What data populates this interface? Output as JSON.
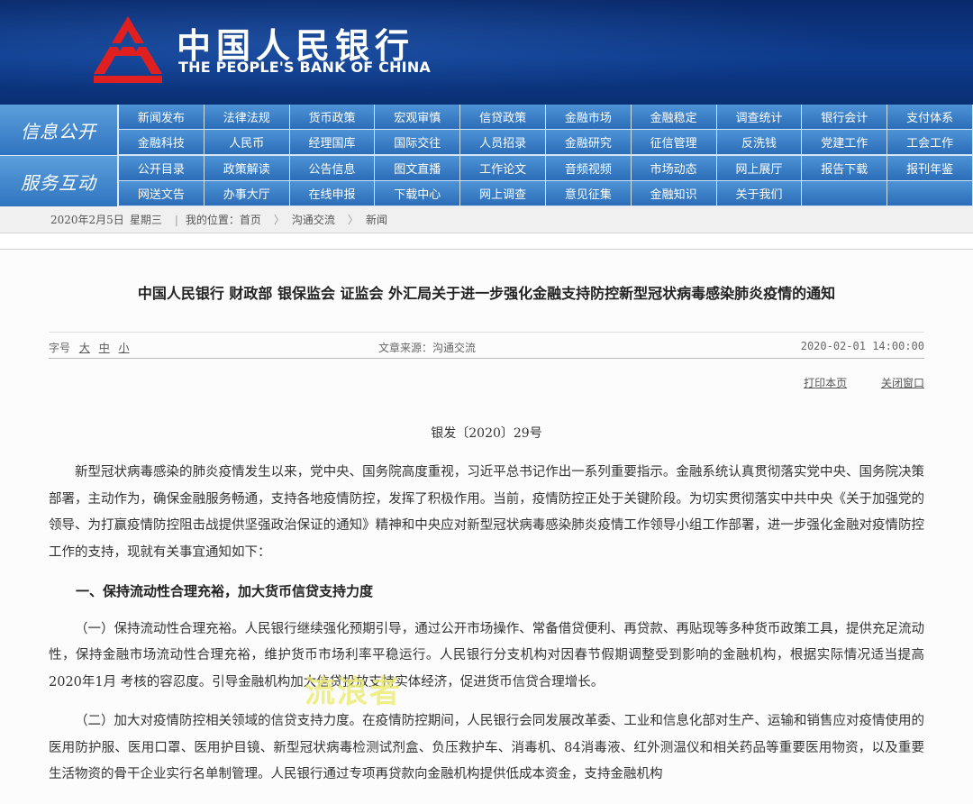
{
  "header": {
    "bank_name_cn": "中国人民银行",
    "bank_name_en": "THE PEOPLE'S BANK OF CHINA",
    "logo_icon": "pboc-logo-icon",
    "logo_color": "#e02020"
  },
  "nav": {
    "section1_label": "信息公开",
    "section1_items": [
      "新闻发布",
      "法律法规",
      "货币政策",
      "宏观审慎",
      "信贷政策",
      "金融市场",
      "金融稳定",
      "调查统计",
      "银行会计",
      "支付体系",
      "金融科技",
      "人民币",
      "经理国库",
      "国际交往",
      "人员招录",
      "金融研究",
      "征信管理",
      "反洗钱",
      "党建工作",
      "工会工作"
    ],
    "section2_label": "服务互动",
    "section2_items": [
      "公开目录",
      "政策解读",
      "公告信息",
      "图文直播",
      "工作论文",
      "音频视频",
      "市场动态",
      "网上展厅",
      "报告下载",
      "报刊年鉴",
      "网送文告",
      "办事大厅",
      "在线申报",
      "下载中心",
      "网上调查",
      "意见征集",
      "金融知识",
      "关于我们",
      "",
      ""
    ]
  },
  "breadcrumb": {
    "date": "2020年2月5日",
    "weekday": "星期三",
    "prefix": "我的位置：首页",
    "level1": "沟通交流",
    "level2": "新闻",
    "separator": "〉"
  },
  "article": {
    "title": "中国人民银行 财政部 银保监会 证监会 外汇局关于进一步强化金融支持防控新型冠状病毒感染肺炎疫情的通知",
    "font_size_label": "字号",
    "font_sizes": [
      "大",
      "中",
      "小"
    ],
    "source": "文章来源：沟通交流",
    "date": "2020-02-01 14:00:00",
    "print_label": "打印本页",
    "close_label": "关闭窗口",
    "doc_number": "银发〔2020〕29号",
    "para1": "新型冠状病毒感染的肺炎疫情发生以来，党中央、国务院高度重视，习近平总书记作出一系列重要指示。金融系统认真贯彻落实党中央、国务院决策部署，主动作为，确保金融服务畅通，支持各地疫情防控，发挥了积极作用。当前，疫情防控正处于关键阶段。为切实贯彻落实中共中央《关于加强党的领导、为打赢疫情防控阻击战提供坚强政治保证的通知》精神和中央应对新型冠状病毒感染肺炎疫情工作领导小组工作部署，进一步强化金融对疫情防控工作的支持，现就有关事宜通知如下：",
    "heading1": "一、保持流动性合理充裕，加大货币信贷支持力度",
    "para2": "（一）保持流动性合理充裕。人民银行继续强化预期引导，通过公开市场操作、常备借贷便利、再贷款、再贴现等多种货币政策工具，提供充足流动性，保持金融市场流动性合理充裕，维护货币市场利率平稳运行。人民银行分支机构对因春节假期调整受到影响的金融机构，根据实际情况适当提高2020年1月 考核的容忍度。引导金融机构加大信贷投放支持实体经济，促进货币信贷合理增长。",
    "para3": "（二）加大对疫情防控相关领域的信贷支持力度。在疫情防控期间，人民银行会同发展改革委、工业和信息化部对生产、运输和销售应对疫情使用的医用防护服、医用口罩、医用护目镜、新型冠状病毒检测试剂盒、负压救护车、消毒机、84消毒液、红外测温仪和相关药品等重要医用物资，以及重要生活物资的骨干企业实行名单制管理。人民银行通过专项再贷款向金融机构提供低成本资金，支持金融机构",
    "watermark": "流浪者"
  }
}
